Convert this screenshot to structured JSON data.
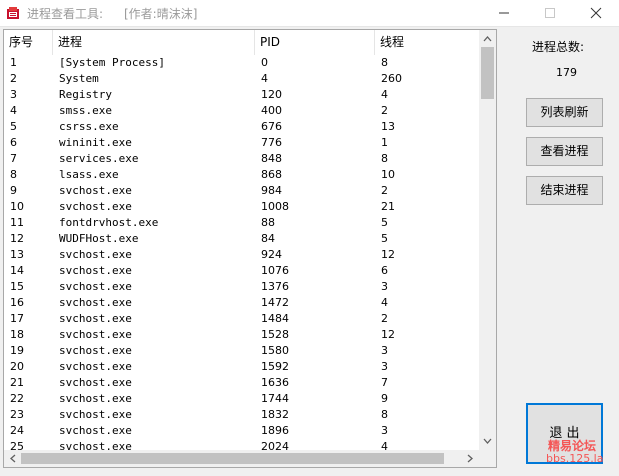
{
  "window": {
    "title": "进程查看工具:",
    "author": "[作者:晴沫沫]"
  },
  "columns": [
    "序号",
    "进程",
    "PID",
    "线程"
  ],
  "rows": [
    [
      "1",
      "[System Process]",
      "0",
      "8"
    ],
    [
      "2",
      "System",
      "4",
      "260"
    ],
    [
      "3",
      "Registry",
      "120",
      "4"
    ],
    [
      "4",
      "smss.exe",
      "400",
      "2"
    ],
    [
      "5",
      "csrss.exe",
      "676",
      "13"
    ],
    [
      "6",
      "wininit.exe",
      "776",
      "1"
    ],
    [
      "7",
      "services.exe",
      "848",
      "8"
    ],
    [
      "8",
      "lsass.exe",
      "868",
      "10"
    ],
    [
      "9",
      "svchost.exe",
      "984",
      "2"
    ],
    [
      "10",
      "svchost.exe",
      "1008",
      "21"
    ],
    [
      "11",
      "fontdrvhost.exe",
      "88",
      "5"
    ],
    [
      "12",
      "WUDFHost.exe",
      "84",
      "5"
    ],
    [
      "13",
      "svchost.exe",
      "924",
      "12"
    ],
    [
      "14",
      "svchost.exe",
      "1076",
      "6"
    ],
    [
      "15",
      "svchost.exe",
      "1376",
      "3"
    ],
    [
      "16",
      "svchost.exe",
      "1472",
      "4"
    ],
    [
      "17",
      "svchost.exe",
      "1484",
      "2"
    ],
    [
      "18",
      "svchost.exe",
      "1528",
      "12"
    ],
    [
      "19",
      "svchost.exe",
      "1580",
      "3"
    ],
    [
      "20",
      "svchost.exe",
      "1592",
      "3"
    ],
    [
      "21",
      "svchost.exe",
      "1636",
      "7"
    ],
    [
      "22",
      "svchost.exe",
      "1744",
      "9"
    ],
    [
      "23",
      "svchost.exe",
      "1832",
      "8"
    ],
    [
      "24",
      "svchost.exe",
      "1896",
      "3"
    ],
    [
      "25",
      "svchost.exe",
      "2024",
      "4"
    ]
  ],
  "side": {
    "total_label": "进程总数:",
    "total_value": "179",
    "refresh_label": "列表刷新",
    "view_label": "查看进程",
    "end_label": "结束进程",
    "exit_label": "退 出"
  },
  "watermark": {
    "line1": "精易论坛",
    "line2": "bbs.125.la"
  }
}
